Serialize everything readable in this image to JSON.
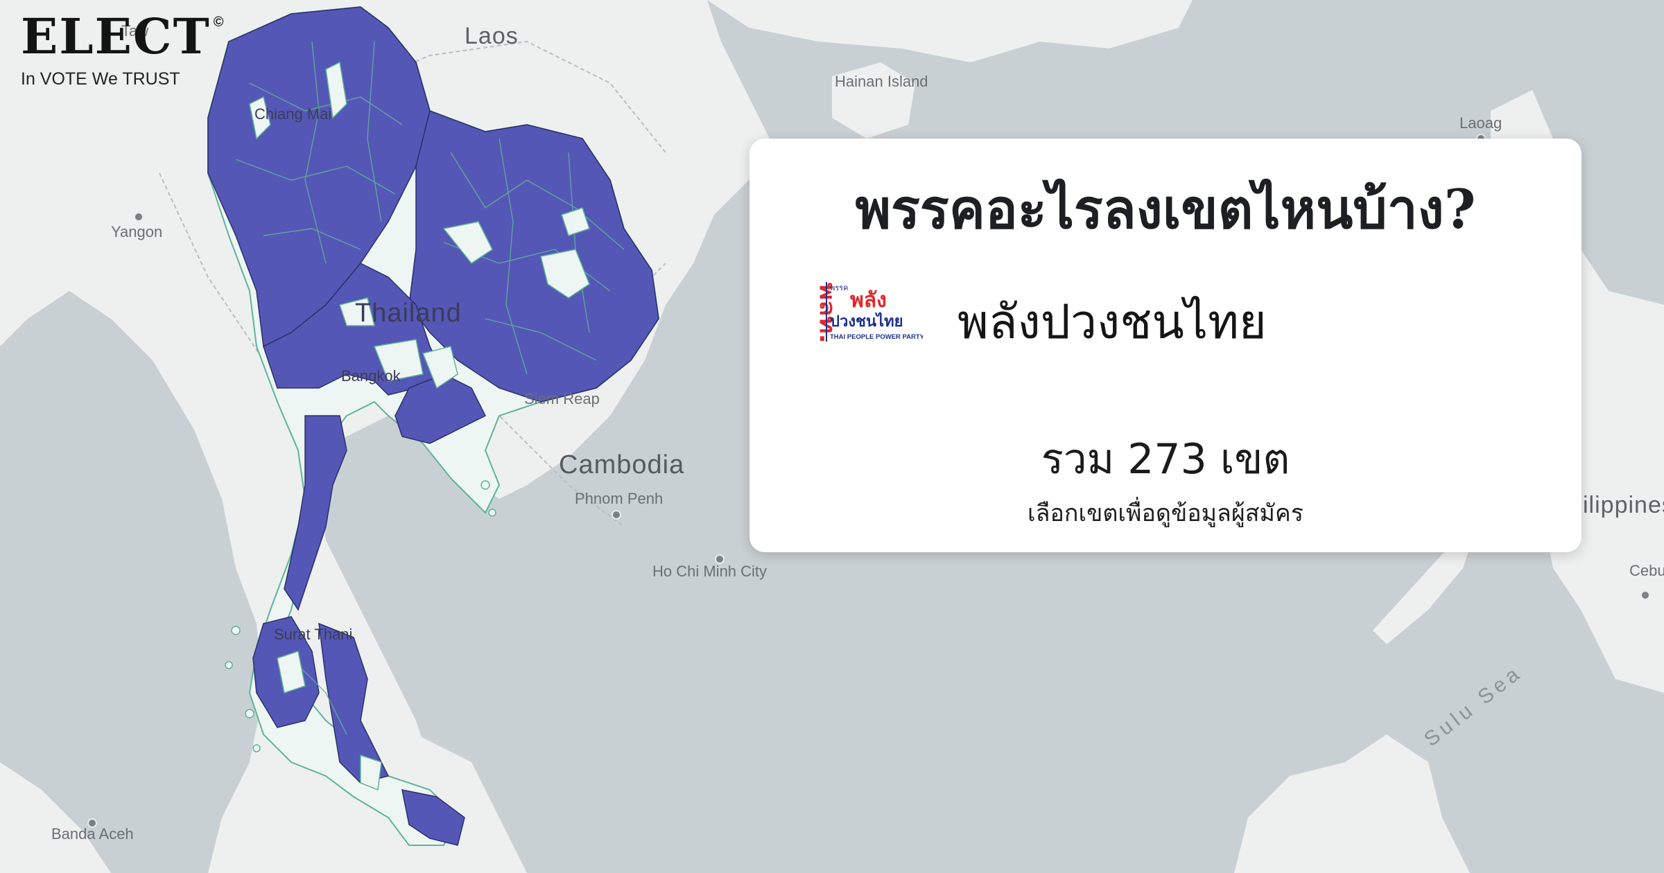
{
  "brand": {
    "name": "ELECT",
    "mark": "©",
    "tagline": "In VOTE We TRUST"
  },
  "card": {
    "title": "พรรคอะไรลงเขตไหนบ้าง?",
    "party_name": "พลังปวงชนไทย",
    "party_logo": {
      "abbr": "พลท.",
      "prefix": "พรรค",
      "line1": "พลัง",
      "line2": "ปวงชนไทย",
      "english": "THAI PEOPLE POWER PARTY"
    },
    "seat_total": "รวม 273 เขต",
    "hint": "เลือกเขตเพื่อดูข้อมูลผู้สมัคร"
  },
  "map_labels": {
    "laos": "Laos",
    "hainan": "Hainan Island",
    "laoag": "Laoag",
    "yangon": "Yangon",
    "chiang_mai": "Chiang Mai",
    "thailand": "Thailand",
    "bangkok": "Bangkok",
    "siem_reap": "Siem Reap",
    "cambodia": "Cambodia",
    "phnom_penh": "Phnom Penh",
    "hcmc": "Ho Chi Minh City",
    "philippines": "ilippines",
    "cebu": "Cebu",
    "surat_thani": "Surat Thani",
    "sulu_sea": "Sulu Sea",
    "banda_aceh": "Banda Aceh",
    "top_partial": "Taw"
  },
  "colors": {
    "party_fill": "#5557b6",
    "other_fill": "#eef6f3",
    "boundary": "#5fb39a",
    "land": "#eef0f0",
    "sea": "#c9d0d3",
    "party_red": "#e0262b",
    "party_blue": "#1d2f8f"
  }
}
